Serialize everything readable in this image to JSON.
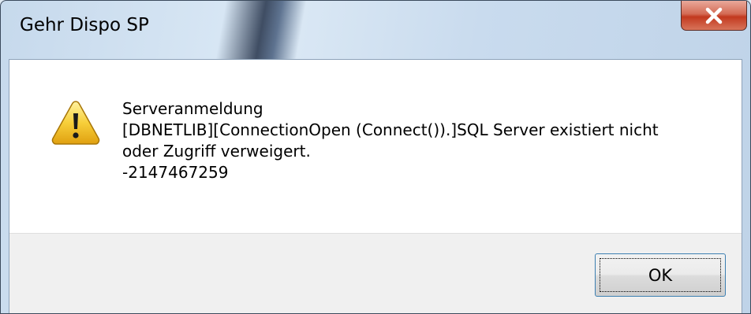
{
  "window": {
    "title": "Gehr Dispo SP",
    "close_glyph": "x",
    "close_icon": "close-icon"
  },
  "message": {
    "icon": "warning-icon",
    "lines": [
      "Serveranmeldung",
      "[DBNETLIB][ConnectionOpen (Connect()).]SQL Server existiert nicht",
      "oder Zugriff verweigert.",
      "-2147467259"
    ]
  },
  "buttons": {
    "ok_label": "OK"
  },
  "colors": {
    "close_button": "#c2391f",
    "warning": "#f2c230",
    "footer": "#f0f0f0",
    "focus_border": "#3c7fb1"
  }
}
